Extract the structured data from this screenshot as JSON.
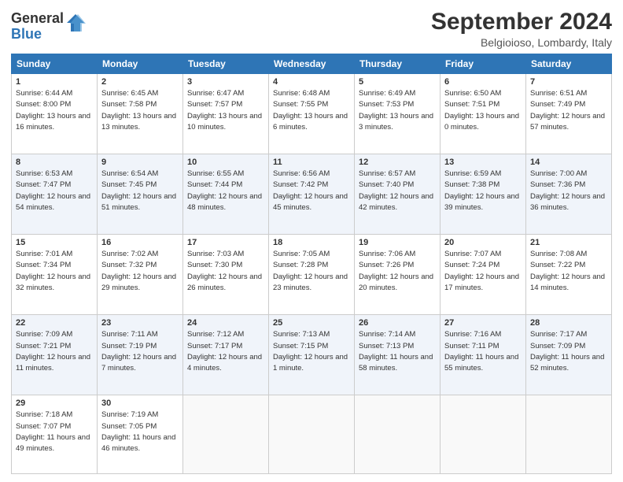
{
  "logo": {
    "line1": "General",
    "line2": "Blue"
  },
  "title": "September 2024",
  "subtitle": "Belgioioso, Lombardy, Italy",
  "headers": [
    "Sunday",
    "Monday",
    "Tuesday",
    "Wednesday",
    "Thursday",
    "Friday",
    "Saturday"
  ],
  "weeks": [
    [
      {
        "day": "1",
        "sunrise": "6:44 AM",
        "sunset": "8:00 PM",
        "daylight": "13 hours and 16 minutes."
      },
      {
        "day": "2",
        "sunrise": "6:45 AM",
        "sunset": "7:58 PM",
        "daylight": "13 hours and 13 minutes."
      },
      {
        "day": "3",
        "sunrise": "6:47 AM",
        "sunset": "7:57 PM",
        "daylight": "13 hours and 10 minutes."
      },
      {
        "day": "4",
        "sunrise": "6:48 AM",
        "sunset": "7:55 PM",
        "daylight": "13 hours and 6 minutes."
      },
      {
        "day": "5",
        "sunrise": "6:49 AM",
        "sunset": "7:53 PM",
        "daylight": "13 hours and 3 minutes."
      },
      {
        "day": "6",
        "sunrise": "6:50 AM",
        "sunset": "7:51 PM",
        "daylight": "13 hours and 0 minutes."
      },
      {
        "day": "7",
        "sunrise": "6:51 AM",
        "sunset": "7:49 PM",
        "daylight": "12 hours and 57 minutes."
      }
    ],
    [
      {
        "day": "8",
        "sunrise": "6:53 AM",
        "sunset": "7:47 PM",
        "daylight": "12 hours and 54 minutes."
      },
      {
        "day": "9",
        "sunrise": "6:54 AM",
        "sunset": "7:45 PM",
        "daylight": "12 hours and 51 minutes."
      },
      {
        "day": "10",
        "sunrise": "6:55 AM",
        "sunset": "7:44 PM",
        "daylight": "12 hours and 48 minutes."
      },
      {
        "day": "11",
        "sunrise": "6:56 AM",
        "sunset": "7:42 PM",
        "daylight": "12 hours and 45 minutes."
      },
      {
        "day": "12",
        "sunrise": "6:57 AM",
        "sunset": "7:40 PM",
        "daylight": "12 hours and 42 minutes."
      },
      {
        "day": "13",
        "sunrise": "6:59 AM",
        "sunset": "7:38 PM",
        "daylight": "12 hours and 39 minutes."
      },
      {
        "day": "14",
        "sunrise": "7:00 AM",
        "sunset": "7:36 PM",
        "daylight": "12 hours and 36 minutes."
      }
    ],
    [
      {
        "day": "15",
        "sunrise": "7:01 AM",
        "sunset": "7:34 PM",
        "daylight": "12 hours and 32 minutes."
      },
      {
        "day": "16",
        "sunrise": "7:02 AM",
        "sunset": "7:32 PM",
        "daylight": "12 hours and 29 minutes."
      },
      {
        "day": "17",
        "sunrise": "7:03 AM",
        "sunset": "7:30 PM",
        "daylight": "12 hours and 26 minutes."
      },
      {
        "day": "18",
        "sunrise": "7:05 AM",
        "sunset": "7:28 PM",
        "daylight": "12 hours and 23 minutes."
      },
      {
        "day": "19",
        "sunrise": "7:06 AM",
        "sunset": "7:26 PM",
        "daylight": "12 hours and 20 minutes."
      },
      {
        "day": "20",
        "sunrise": "7:07 AM",
        "sunset": "7:24 PM",
        "daylight": "12 hours and 17 minutes."
      },
      {
        "day": "21",
        "sunrise": "7:08 AM",
        "sunset": "7:22 PM",
        "daylight": "12 hours and 14 minutes."
      }
    ],
    [
      {
        "day": "22",
        "sunrise": "7:09 AM",
        "sunset": "7:21 PM",
        "daylight": "12 hours and 11 minutes."
      },
      {
        "day": "23",
        "sunrise": "7:11 AM",
        "sunset": "7:19 PM",
        "daylight": "12 hours and 7 minutes."
      },
      {
        "day": "24",
        "sunrise": "7:12 AM",
        "sunset": "7:17 PM",
        "daylight": "12 hours and 4 minutes."
      },
      {
        "day": "25",
        "sunrise": "7:13 AM",
        "sunset": "7:15 PM",
        "daylight": "12 hours and 1 minute."
      },
      {
        "day": "26",
        "sunrise": "7:14 AM",
        "sunset": "7:13 PM",
        "daylight": "11 hours and 58 minutes."
      },
      {
        "day": "27",
        "sunrise": "7:16 AM",
        "sunset": "7:11 PM",
        "daylight": "11 hours and 55 minutes."
      },
      {
        "day": "28",
        "sunrise": "7:17 AM",
        "sunset": "7:09 PM",
        "daylight": "11 hours and 52 minutes."
      }
    ],
    [
      {
        "day": "29",
        "sunrise": "7:18 AM",
        "sunset": "7:07 PM",
        "daylight": "11 hours and 49 minutes."
      },
      {
        "day": "30",
        "sunrise": "7:19 AM",
        "sunset": "7:05 PM",
        "daylight": "11 hours and 46 minutes."
      },
      null,
      null,
      null,
      null,
      null
    ]
  ]
}
